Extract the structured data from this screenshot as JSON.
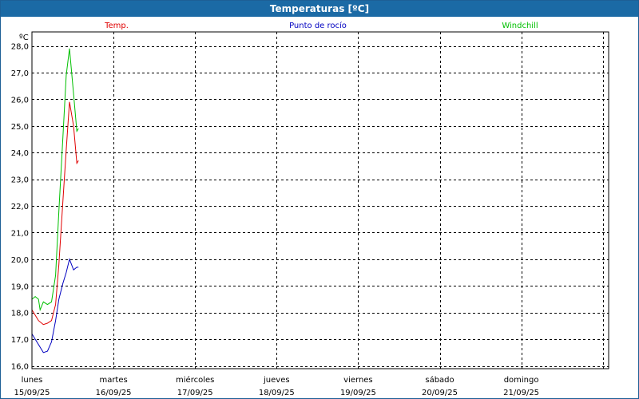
{
  "window": {
    "title": "Temperaturas [ºC]"
  },
  "chart_data": {
    "type": "line",
    "title": "Temperaturas [ºC]",
    "ylabel": "ºC",
    "xlabel": "",
    "ylim": [
      16.0,
      28.0
    ],
    "yticks": [
      "16,0",
      "17,0",
      "18,0",
      "19,0",
      "20,0",
      "21,0",
      "22,0",
      "23,0",
      "24,0",
      "25,0",
      "26,0",
      "27,0",
      "28,0"
    ],
    "xrange_days": [
      0,
      7
    ],
    "day_labels": [
      {
        "day": "lunes",
        "date": "15/09/25"
      },
      {
        "day": "martes",
        "date": "16/09/25"
      },
      {
        "day": "miércoles",
        "date": "17/09/25"
      },
      {
        "day": "jueves",
        "date": "18/09/25"
      },
      {
        "day": "viernes",
        "date": "19/09/25"
      },
      {
        "day": "sábado",
        "date": "20/09/25"
      },
      {
        "day": "domingo",
        "date": "21/09/25"
      }
    ],
    "grid": true,
    "legend_position": "top",
    "series": [
      {
        "name": "Temp.",
        "color": "#e00000",
        "x": [
          0.0,
          0.04,
          0.08,
          0.14,
          0.19,
          0.24,
          0.29,
          0.33,
          0.38,
          0.42,
          0.46,
          0.51,
          0.55,
          0.57
        ],
        "y": [
          18.1,
          17.9,
          17.7,
          17.55,
          17.6,
          17.7,
          18.3,
          19.8,
          22.2,
          24.1,
          25.9,
          25.0,
          23.6,
          23.7
        ]
      },
      {
        "name": "Punto de rocío",
        "color": "#0000c0",
        "x": [
          0.0,
          0.04,
          0.08,
          0.14,
          0.19,
          0.24,
          0.29,
          0.33,
          0.38,
          0.42,
          0.46,
          0.51,
          0.55,
          0.57
        ],
        "y": [
          17.2,
          17.0,
          16.8,
          16.5,
          16.55,
          16.9,
          17.7,
          18.5,
          19.1,
          19.5,
          20.0,
          19.6,
          19.7,
          19.7
        ]
      },
      {
        "name": "Windchill",
        "color": "#00c000",
        "x": [
          0.0,
          0.04,
          0.08,
          0.1,
          0.14,
          0.19,
          0.24,
          0.29,
          0.33,
          0.38,
          0.42,
          0.46,
          0.51,
          0.55,
          0.57
        ],
        "y": [
          18.5,
          18.6,
          18.5,
          18.1,
          18.4,
          18.3,
          18.4,
          19.4,
          21.8,
          24.6,
          26.9,
          27.9,
          26.2,
          24.8,
          24.9
        ]
      }
    ]
  }
}
